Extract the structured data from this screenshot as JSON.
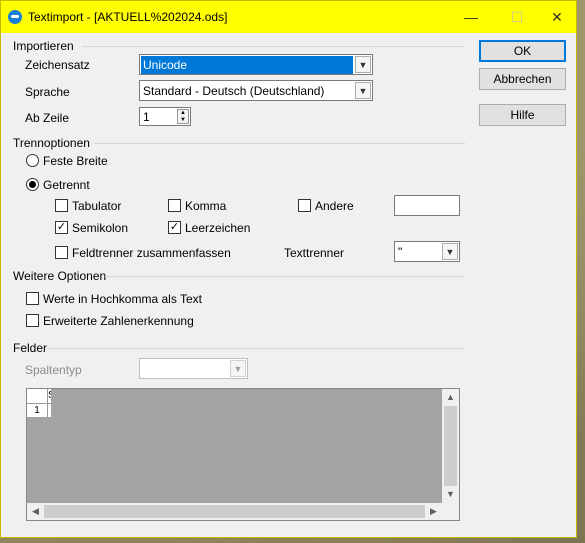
{
  "window": {
    "title": "Textimport - [AKTUELL%202024.ods]",
    "minimize": "—",
    "maximize": "☐",
    "close": "✕"
  },
  "import": {
    "section": "Importieren",
    "charset_label": "Zeichensatz",
    "charset_value": "Unicode",
    "language_label": "Sprache",
    "language_value": "Standard - Deutsch (Deutschland)",
    "from_row_label": "Ab Zeile",
    "from_row_value": "1"
  },
  "separator": {
    "section": "Trennoptionen",
    "fixed_width": "Feste Breite",
    "separated": "Getrennt",
    "tab": "Tabulator",
    "comma": "Komma",
    "other": "Andere",
    "semicolon": "Semikolon",
    "space": "Leerzeichen",
    "merge": "Feldtrenner zusammenfassen",
    "text_delimiter_label": "Texttrenner",
    "text_delimiter_value": "\"",
    "fixed_width_selected": false,
    "separated_selected": true,
    "tab_checked": false,
    "comma_checked": false,
    "other_checked": false,
    "semicolon_checked": true,
    "space_checked": true,
    "merge_checked": false
  },
  "more": {
    "section": "Weitere Optionen",
    "quoted_as_text": "Werte in Hochkomma als Text",
    "detect_numbers": "Erweiterte Zahlenerkennung",
    "quoted_checked": false,
    "detect_checked": false
  },
  "fields": {
    "section": "Felder",
    "column_type_label": "Spaltentyp",
    "col_header": "S",
    "row_header": "1"
  },
  "buttons": {
    "ok": "OK",
    "cancel": "Abbrechen",
    "help": "Hilfe"
  },
  "colors": {
    "titlebar": "#ffff00",
    "accent": "#0078d7"
  }
}
